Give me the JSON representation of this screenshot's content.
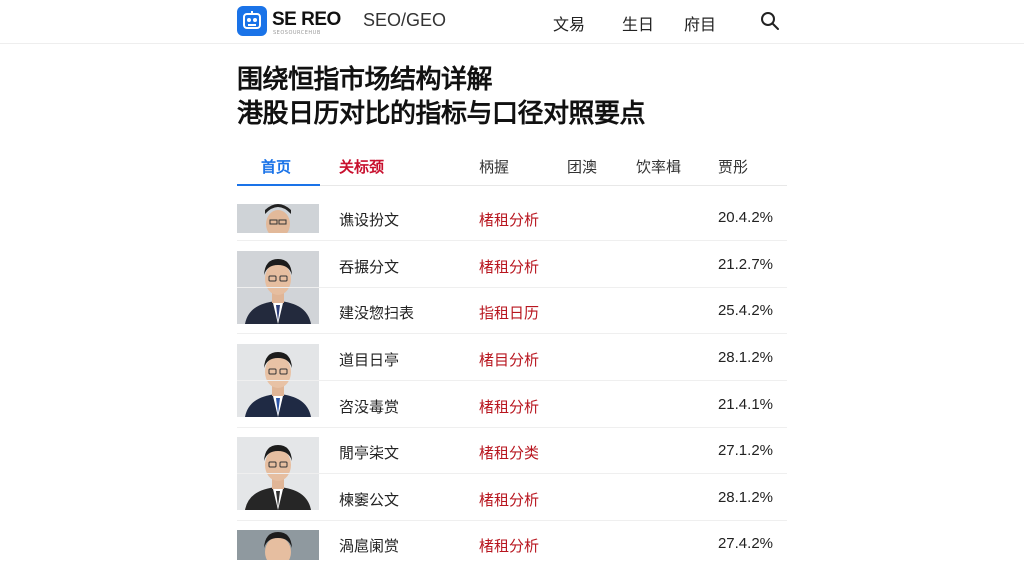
{
  "header": {
    "logo_text": "SE REO",
    "logo_sub": "SEOSOURCEHUB",
    "brand_tag": "SEO/GEO",
    "nav": [
      "文易",
      "生日",
      "府目"
    ]
  },
  "title": {
    "line1": "围绕恒指市场结构详解",
    "line2": "港股日历对比的指标与口径对照要点"
  },
  "tabs": [
    "首页",
    "关标颈",
    "柄握",
    "团澳",
    "饮率楫",
    "贾彤"
  ],
  "rows": [
    {
      "name": "谯设扮文",
      "tag": "楮租分析",
      "pct": "20.4.2%"
    },
    {
      "name": "吞搌分文",
      "tag": "楮租分析",
      "pct": "21.2.7%"
    },
    {
      "name": "建没惣扫表",
      "tag": "指租日历",
      "pct": "25.4.2%"
    },
    {
      "name": "道目日亭",
      "tag": "楮目分析",
      "pct": "28.1.2%"
    },
    {
      "name": "咨没毒赏",
      "tag": "楮租分析",
      "pct": "21.4.1%"
    },
    {
      "name": "閒亭柒文",
      "tag": "楮租分类",
      "pct": "27.1.2%"
    },
    {
      "name": "楝䆧公文",
      "tag": "楮租分析",
      "pct": "28.1.2%"
    },
    {
      "name": "渦扈阑赏",
      "tag": "楮租分析",
      "pct": "27.4.2%"
    }
  ],
  "colors": {
    "accent": "#1a73e8",
    "tag_red": "#b8161f"
  }
}
